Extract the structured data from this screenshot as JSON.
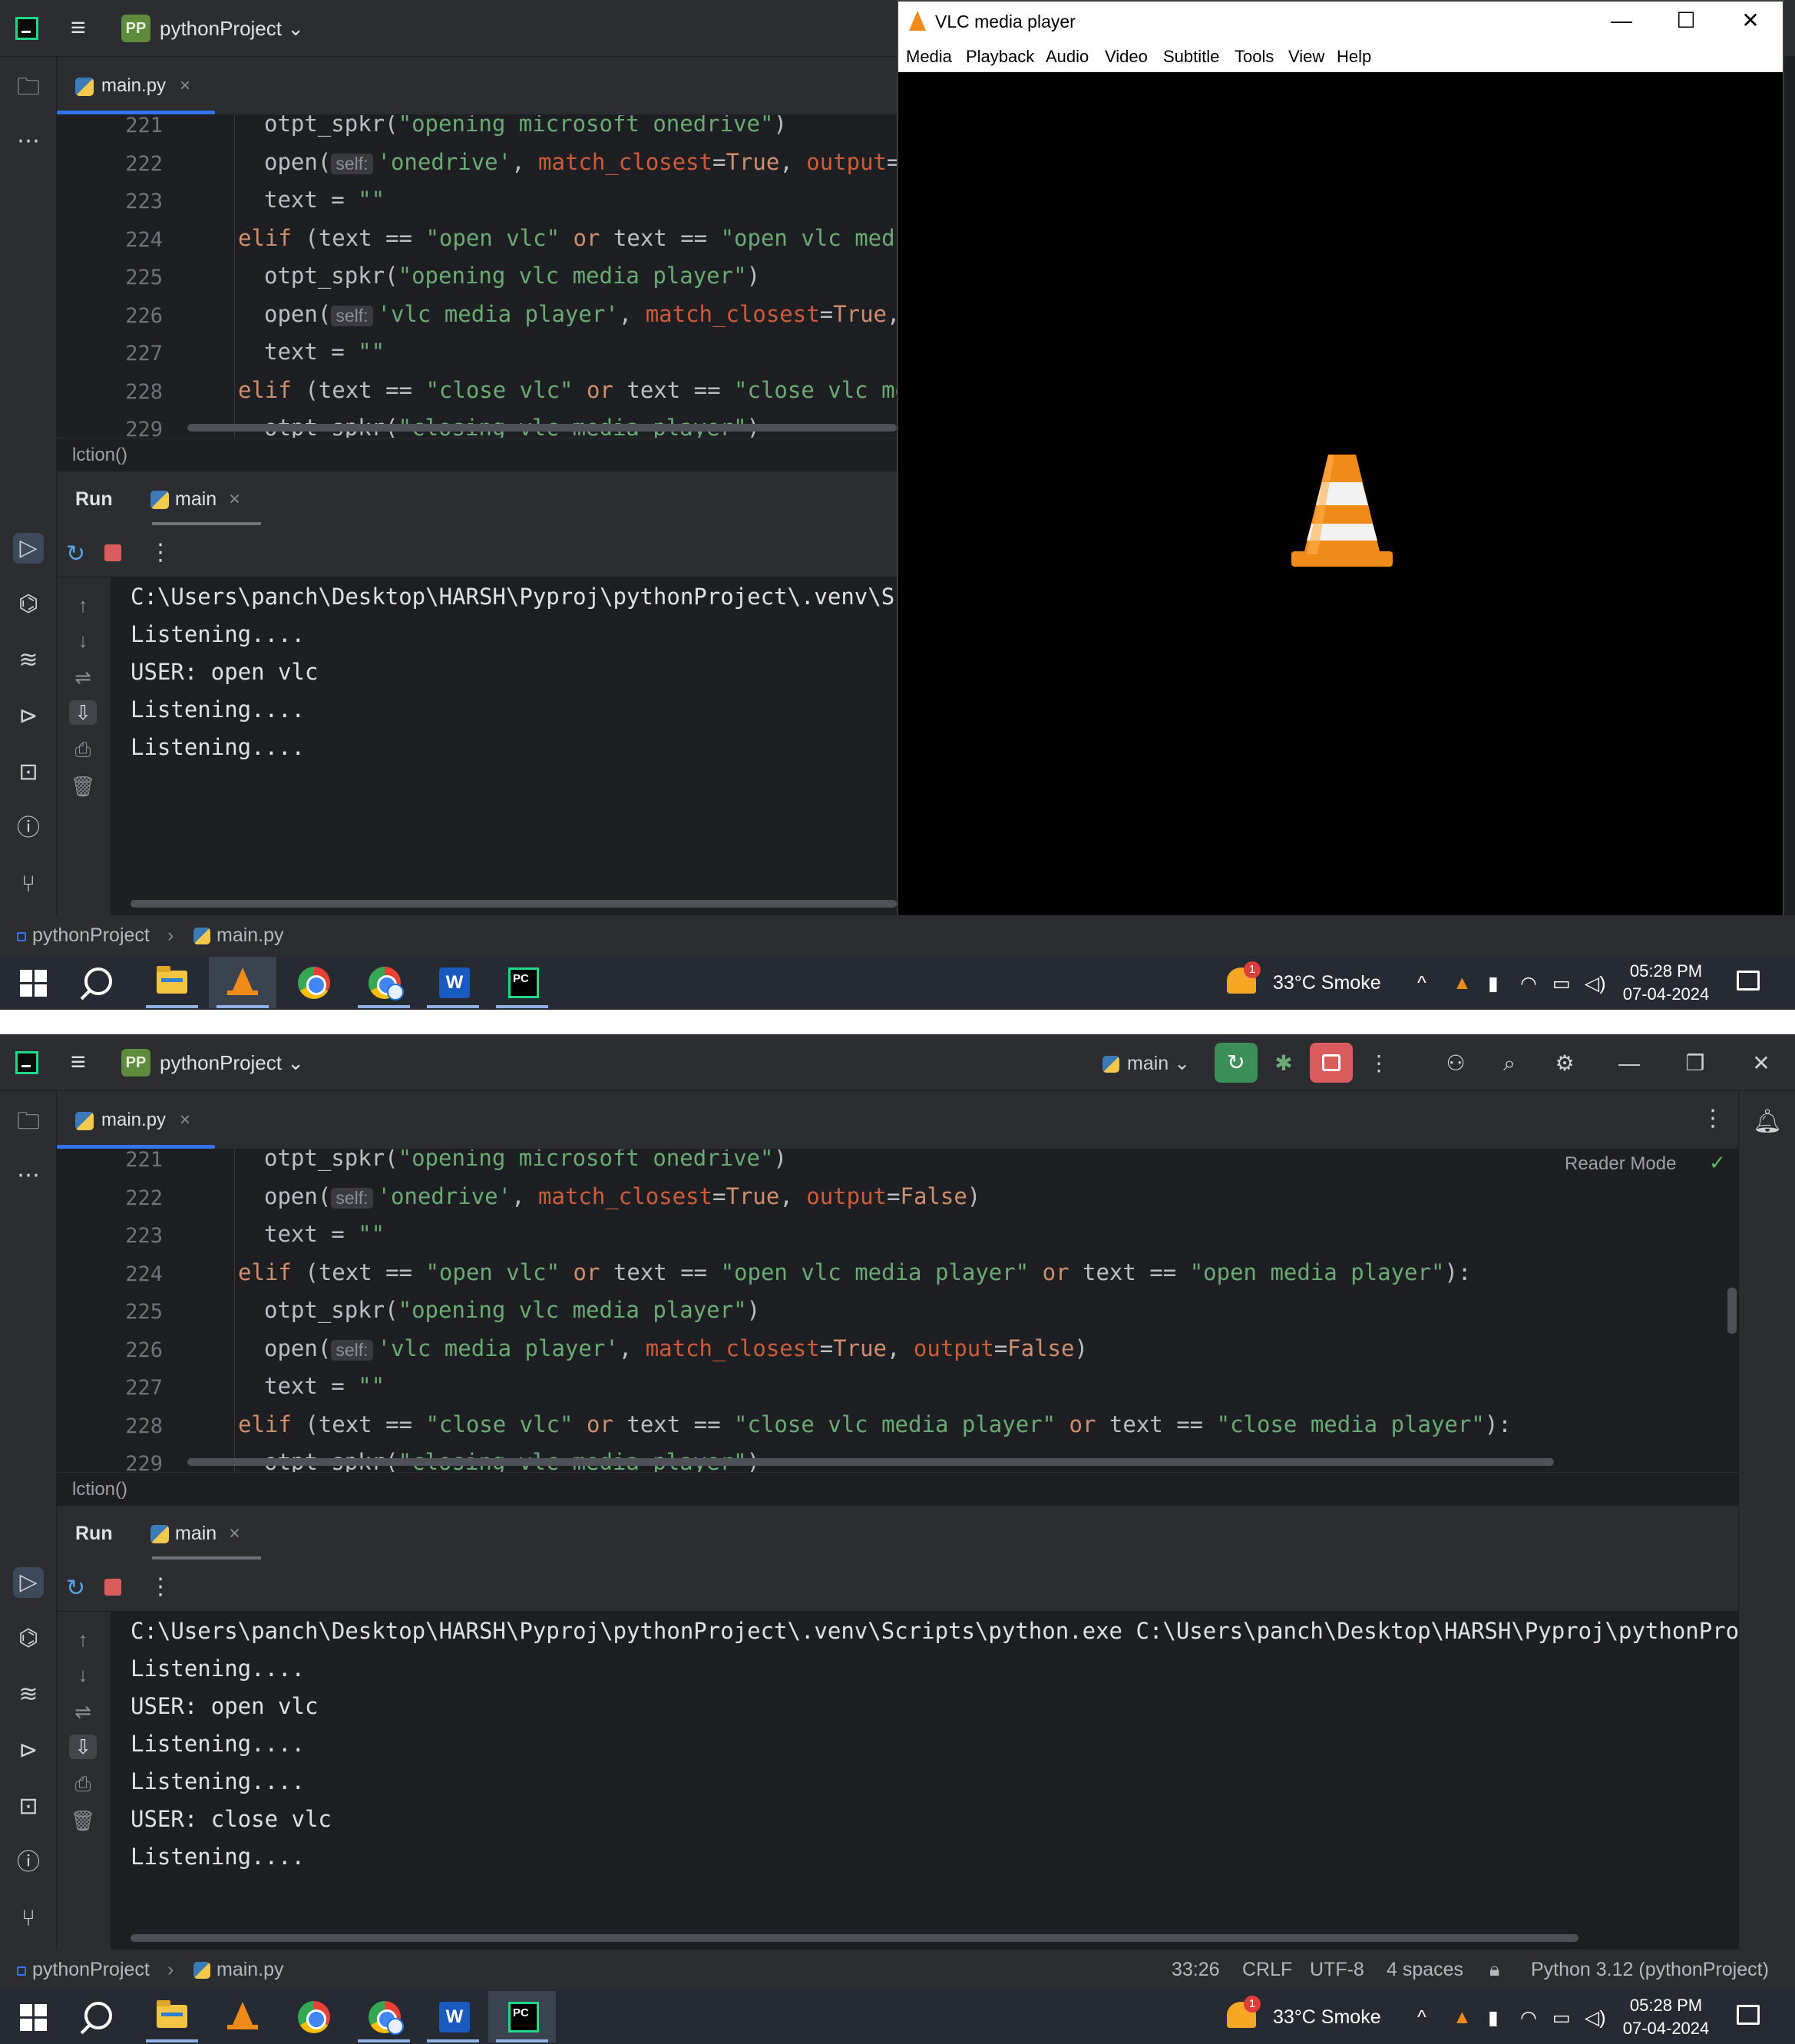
{
  "ide": {
    "project_badge": "PP",
    "project_name": "pythonProject",
    "file_tab": "main.py",
    "breadcrumb_fn": "lction()",
    "run_label": "Run",
    "run_tab": "main",
    "run_config": "main",
    "reader_mode": "Reader Mode",
    "status_project": "pythonProject",
    "status_file": "main.py",
    "status_pos": "33:26",
    "status_eol": "CRLF",
    "status_enc": "UTF-8",
    "status_indent": "4 spaces",
    "status_interp": "Python 3.12 (pythonProject)"
  },
  "code": {
    "line_numbers": [
      "221",
      "222",
      "223",
      "224",
      "225",
      "226",
      "227",
      "228",
      "229"
    ],
    "lines": [
      [
        {
          "t": "otpt_spkr(",
          "c": ""
        },
        {
          "t": "\"opening microsoft onedrive\"",
          "c": "st"
        },
        {
          "t": ")",
          "c": ""
        }
      ],
      [
        {
          "t": "open(",
          "c": ""
        },
        {
          "t": "self:",
          "c": "hint"
        },
        {
          "t": "'onedrive'",
          "c": "st"
        },
        {
          "t": ", ",
          "c": ""
        },
        {
          "t": "match_closest",
          "c": "nm"
        },
        {
          "t": "=",
          "c": ""
        },
        {
          "t": "True",
          "c": "kw"
        },
        {
          "t": ", ",
          "c": ""
        },
        {
          "t": "output",
          "c": "nm"
        },
        {
          "t": "=",
          "c": ""
        },
        {
          "t": "False",
          "c": "kw"
        },
        {
          "t": ")",
          "c": ""
        }
      ],
      [
        {
          "t": "text = ",
          "c": ""
        },
        {
          "t": "\"\"",
          "c": "st"
        }
      ],
      [
        {
          "t": "elif ",
          "c": "kw"
        },
        {
          "t": "(text == ",
          "c": ""
        },
        {
          "t": "\"open vlc\"",
          "c": "st"
        },
        {
          "t": " or ",
          "c": "kw"
        },
        {
          "t": "text == ",
          "c": ""
        },
        {
          "t": "\"open vlc media player\"",
          "c": "st"
        },
        {
          "t": " or ",
          "c": "kw"
        },
        {
          "t": "text == ",
          "c": ""
        },
        {
          "t": "\"open media player\"",
          "c": "st"
        },
        {
          "t": "):",
          "c": ""
        }
      ],
      [
        {
          "t": "otpt_spkr(",
          "c": ""
        },
        {
          "t": "\"opening vlc media player\"",
          "c": "st"
        },
        {
          "t": ")",
          "c": ""
        }
      ],
      [
        {
          "t": "open(",
          "c": ""
        },
        {
          "t": "self:",
          "c": "hint"
        },
        {
          "t": "'vlc media player'",
          "c": "st"
        },
        {
          "t": ", ",
          "c": ""
        },
        {
          "t": "match_closest",
          "c": "nm"
        },
        {
          "t": "=",
          "c": ""
        },
        {
          "t": "True",
          "c": "kw"
        },
        {
          "t": ", ",
          "c": ""
        },
        {
          "t": "output",
          "c": "nm"
        },
        {
          "t": "=",
          "c": ""
        },
        {
          "t": "False",
          "c": "kw"
        },
        {
          "t": ")",
          "c": ""
        }
      ],
      [
        {
          "t": "text = ",
          "c": ""
        },
        {
          "t": "\"\"",
          "c": "st"
        }
      ],
      [
        {
          "t": "elif ",
          "c": "kw"
        },
        {
          "t": "(text == ",
          "c": ""
        },
        {
          "t": "\"close vlc\"",
          "c": "st"
        },
        {
          "t": " or ",
          "c": "kw"
        },
        {
          "t": "text == ",
          "c": ""
        },
        {
          "t": "\"close vlc media player\"",
          "c": "st"
        },
        {
          "t": " or ",
          "c": "kw"
        },
        {
          "t": "text == ",
          "c": ""
        },
        {
          "t": "\"close media player\"",
          "c": "st"
        },
        {
          "t": "):",
          "c": ""
        }
      ],
      [
        {
          "t": "otpt_spkr(",
          "c": ""
        },
        {
          "t": "\"closing vlc media player\"",
          "c": "st"
        },
        {
          "t": ")",
          "c": ""
        }
      ]
    ],
    "indent": [
      2,
      2,
      2,
      1,
      2,
      2,
      2,
      1,
      2
    ]
  },
  "console1": [
    "C:\\Users\\panch\\Desktop\\HARSH\\Pyproj\\pythonProject\\.venv\\Scr",
    "Listening....",
    "USER: open vlc",
    "Listening....",
    "Listening...."
  ],
  "console2": [
    "C:\\Users\\panch\\Desktop\\HARSH\\Pyproj\\pythonProject\\.venv\\Scripts\\python.exe C:\\Users\\panch\\Desktop\\HARSH\\Pyproj\\pythonProjec",
    "Listening....",
    "USER: open vlc",
    "Listening....",
    "Listening....",
    "USER: close vlc",
    "Listening...."
  ],
  "vlc": {
    "title": "VLC media player",
    "menu": [
      "Media",
      "Playback",
      "Audio",
      "Video",
      "Subtitle",
      "Tools",
      "View",
      "Help"
    ],
    "minimize": "—",
    "maximize": "☐",
    "close": "✕"
  },
  "taskbar": {
    "weather": "33°C  Smoke",
    "time": "05:28 PM",
    "date": "07-04-2024",
    "tray_icons": [
      "chevron-up-icon",
      "vlc-tray-icon",
      "microphone-icon",
      "wifi-icon",
      "battery-icon",
      "volume-icon"
    ]
  },
  "colors": {
    "ide_bg": "#1e1f22",
    "panel_bg": "#2b2d30",
    "string": "#6aab73",
    "keyword": "#cf8e6d",
    "named_arg": "#ce5c3a",
    "vlc_orange": "#f08a18",
    "taskbar": "#262b33"
  }
}
